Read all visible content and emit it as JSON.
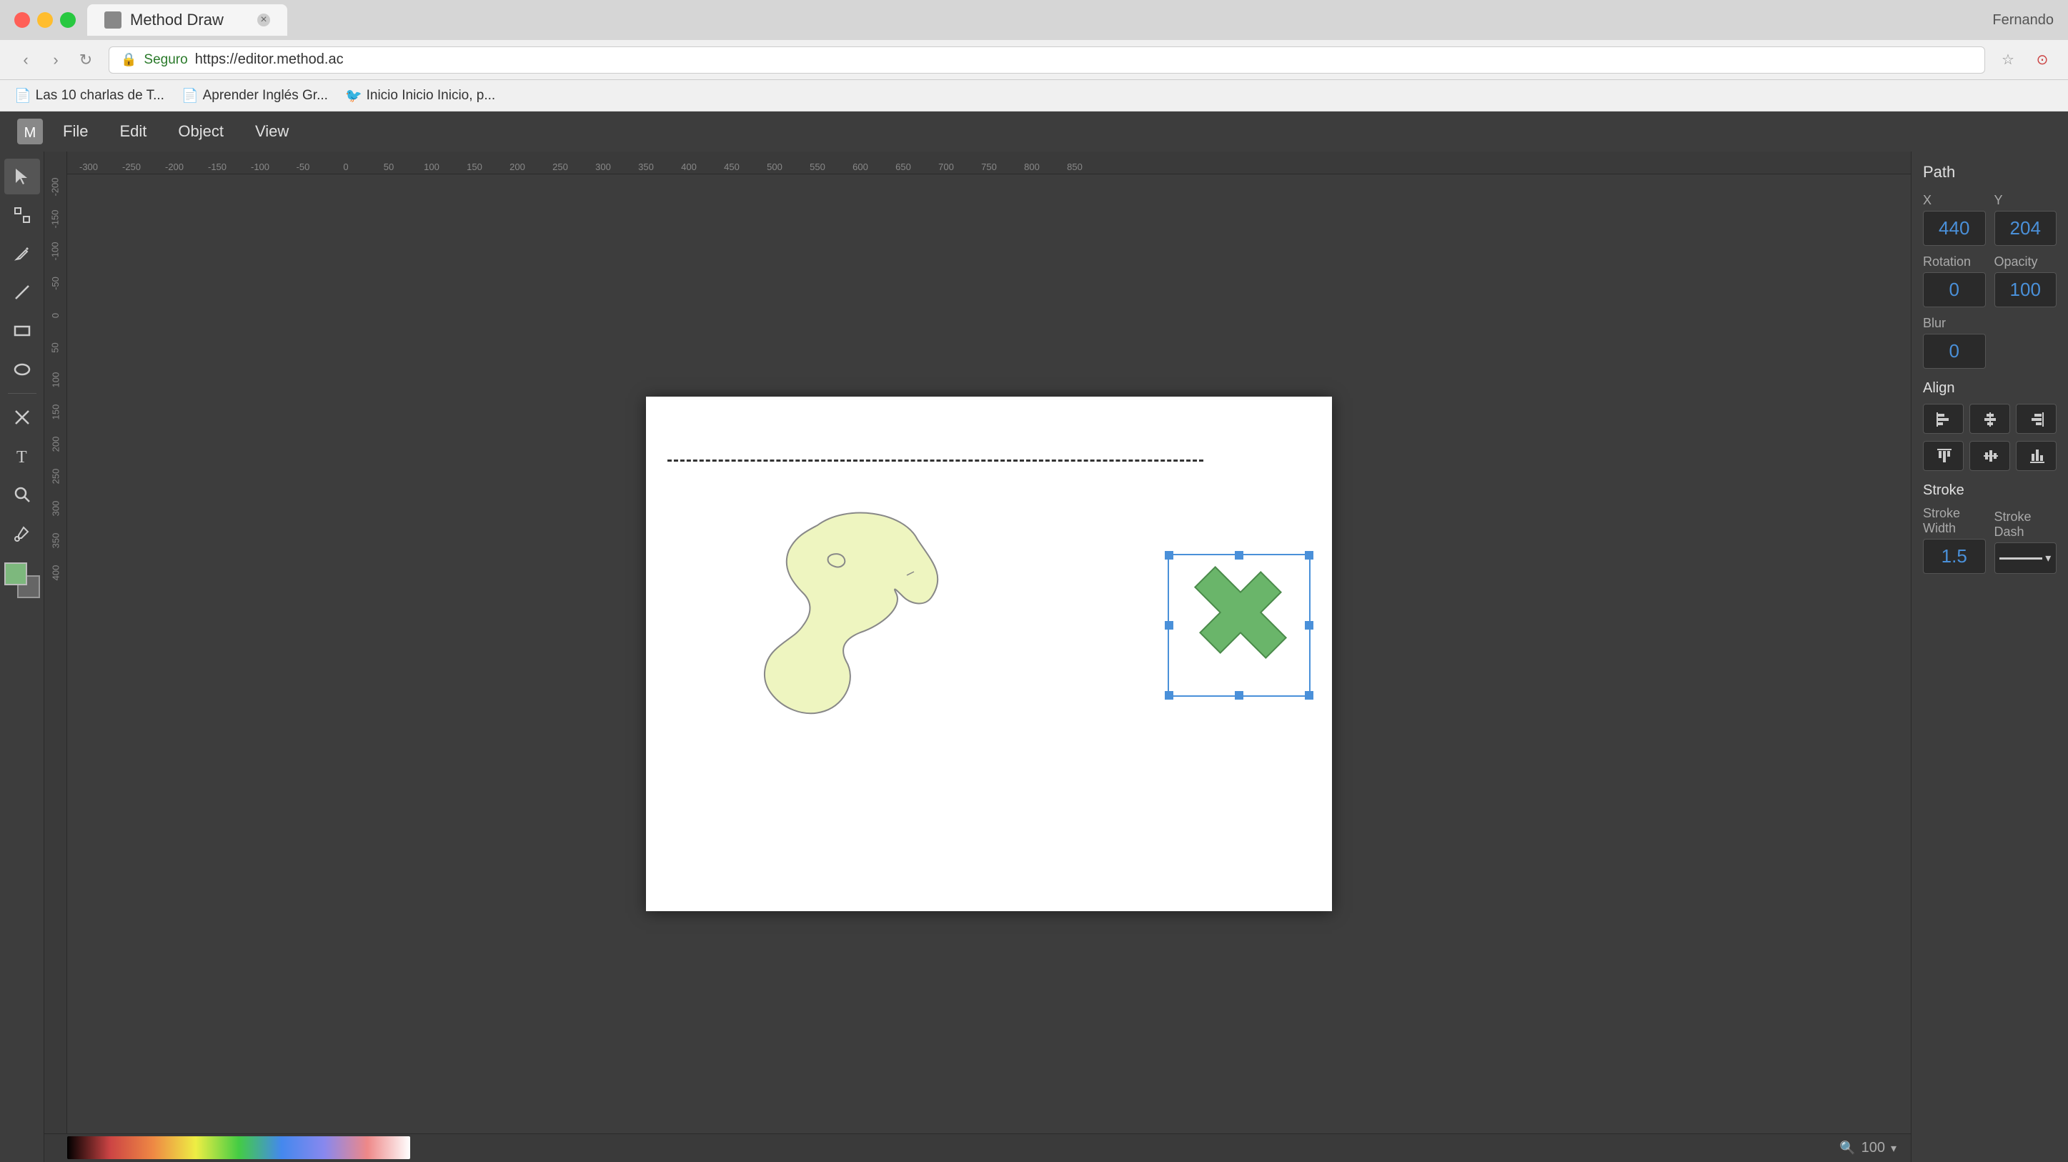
{
  "browser": {
    "traffic_lights": [
      "red",
      "yellow",
      "green"
    ],
    "tab_title": "Method Draw",
    "tab_url": "https://editor.method.ac",
    "nav_back": "‹",
    "nav_forward": "›",
    "nav_refresh": "↻",
    "secure_label": "Seguro",
    "url": "https://editor.method.ac",
    "user": "Fernando",
    "bookmarks": [
      {
        "label": "Las 10 charlas de T...",
        "icon": "📄"
      },
      {
        "label": "Aprender Inglés Gr...",
        "icon": "📄"
      },
      {
        "label": "Inicio Inicio Inicio, p...",
        "icon": "🐦"
      }
    ]
  },
  "menu": {
    "items": [
      "File",
      "Edit",
      "Object",
      "View"
    ]
  },
  "tools": [
    {
      "name": "select",
      "icon": "↖",
      "label": "Select Tool"
    },
    {
      "name": "node",
      "icon": "✦",
      "label": "Node Tool"
    },
    {
      "name": "pencil",
      "icon": "✏",
      "label": "Pencil Tool"
    },
    {
      "name": "line",
      "icon": "╱",
      "label": "Line Tool"
    },
    {
      "name": "rect",
      "icon": "▭",
      "label": "Rectangle Tool"
    },
    {
      "name": "ellipse",
      "icon": "⬭",
      "label": "Ellipse Tool"
    },
    {
      "name": "text-remove",
      "icon": "✖",
      "label": "Remove Tool"
    },
    {
      "name": "text",
      "icon": "T",
      "label": "Text Tool"
    },
    {
      "name": "zoom",
      "icon": "🔍",
      "label": "Zoom Tool"
    },
    {
      "name": "eyedropper",
      "icon": "💉",
      "label": "Eyedropper Tool"
    }
  ],
  "right_panel": {
    "title": "Path",
    "x_label": "X",
    "y_label": "Y",
    "x_value": "440",
    "y_value": "204",
    "rotation_label": "Rotation",
    "rotation_value": "0",
    "opacity_label": "Opacity",
    "opacity_value": "100",
    "blur_label": "Blur",
    "blur_value": "0",
    "align_label": "Align",
    "stroke_label": "Stroke",
    "stroke_width_label": "Stroke Width",
    "stroke_width_value": "1.5",
    "stroke_dash_label": "Stroke Dash"
  },
  "canvas": {
    "zoom_label": "100",
    "zoom_icon": "🔍"
  },
  "ruler": {
    "numbers": [
      "-300",
      "-250",
      "-200",
      "-150",
      "-100",
      "-50",
      "0",
      "50",
      "100",
      "150",
      "200",
      "250",
      "300",
      "350",
      "400",
      "450",
      "500",
      "550",
      "600",
      "650",
      "700",
      "750",
      "800",
      "850"
    ]
  }
}
